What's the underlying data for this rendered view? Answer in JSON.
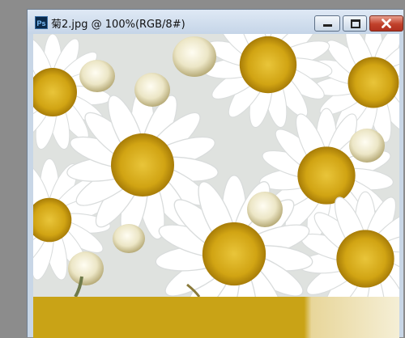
{
  "window": {
    "title": "菊2.jpg @ 100%(RGB/8#)",
    "icon": "photoshop-document-icon",
    "controls": [
      "minimize-icon",
      "maximize-icon",
      "close-icon"
    ]
  },
  "colors": {
    "titlebar": "#cfdeef",
    "close_button": "#c0402a",
    "band": "#c9a316",
    "workspace": "#8c8c8c"
  }
}
